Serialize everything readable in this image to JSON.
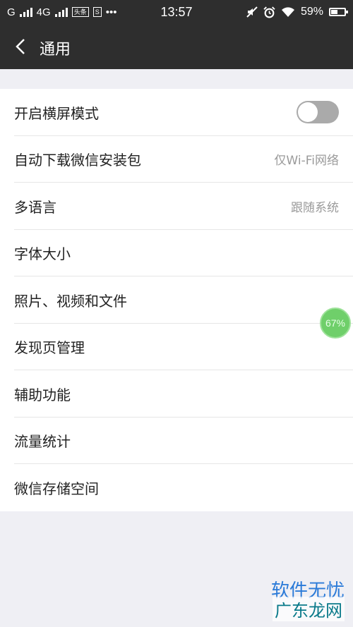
{
  "status_bar": {
    "carrier_g": "G",
    "network_type": "4G",
    "time": "13:57",
    "battery_percent": "59%",
    "battery_level": 0.59,
    "news_app_icon": "头条",
    "icons": [
      "signal-icon",
      "toutiao-icon",
      "s-app-icon",
      "more-dots-icon",
      "mute-icon",
      "alarm-icon",
      "wifi-icon",
      "battery-icon"
    ]
  },
  "nav": {
    "title": "通用",
    "back_icon": "chevron-left-icon"
  },
  "settings": [
    {
      "label": "开启横屏模式",
      "value": "",
      "toggle": false
    },
    {
      "label": "自动下载微信安装包",
      "value": "仅Wi-Fi网络"
    },
    {
      "label": "多语言",
      "value": "跟随系统"
    },
    {
      "label": "字体大小",
      "value": ""
    },
    {
      "label": "照片、视频和文件",
      "value": ""
    },
    {
      "label": "发现页管理",
      "value": ""
    },
    {
      "label": "辅助功能",
      "value": ""
    },
    {
      "label": "流量统计",
      "value": ""
    },
    {
      "label": "微信存储空间",
      "value": ""
    }
  ],
  "float_ball": {
    "text": "67%"
  },
  "watermark": {
    "top": "软件无忧",
    "bottom": "广东龙网"
  },
  "colors": {
    "bar": "#2e2e2e",
    "background": "#efeff4",
    "toggle_off": "#aaaaaa",
    "float_ball": "#6fcf6a"
  }
}
